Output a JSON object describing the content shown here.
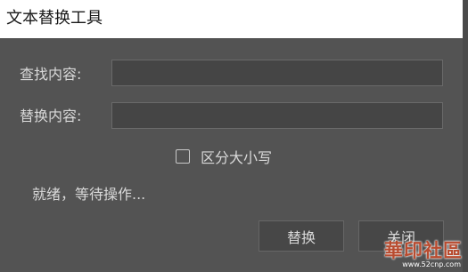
{
  "window": {
    "title": "文本替换工具"
  },
  "form": {
    "find_label": "查找内容:",
    "find_value": "",
    "replace_label": "替换内容:",
    "replace_value": ""
  },
  "options": {
    "case_sensitive_label": "区分大小写",
    "case_sensitive_checked": false
  },
  "status": {
    "text": "就绪，等待操作..."
  },
  "buttons": {
    "replace_label": "替换",
    "close_label": "关闭"
  },
  "watermark": {
    "main": "華印社區",
    "sub": "www.52cnp.com"
  },
  "colors": {
    "background": "#535353",
    "titlebar": "#ffffff",
    "field": "#454545",
    "text": "#d9d9d9",
    "watermark": "#b84b2f"
  }
}
